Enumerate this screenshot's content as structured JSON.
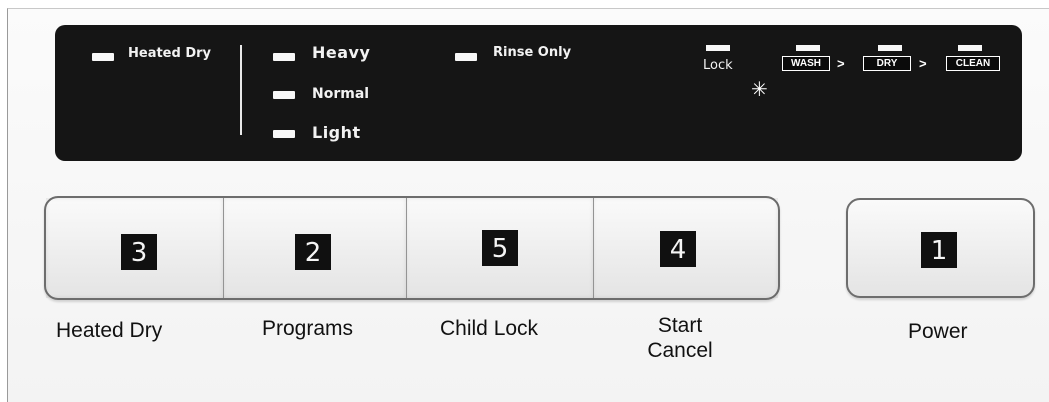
{
  "display": {
    "heated_dry": "Heated Dry",
    "cycles": {
      "heavy": "Heavy",
      "normal": "Normal",
      "light": "Light"
    },
    "rinse_only": "Rinse Only",
    "lock": "Lock",
    "stages": [
      "WASH",
      "DRY",
      "CLEAN"
    ],
    "arrow_glyph": ">",
    "sparkle_glyph": "✳"
  },
  "buttons": [
    {
      "number": "3",
      "label": "Heated Dry"
    },
    {
      "number": "2",
      "label": "Programs"
    },
    {
      "number": "5",
      "label": "Child Lock"
    },
    {
      "number": "4",
      "label": "Start\nCancel"
    }
  ],
  "power": {
    "number": "1",
    "label": "Power"
  },
  "colors": {
    "panel": "#151515",
    "led": "#f7f7f7",
    "badge": "#101010"
  }
}
